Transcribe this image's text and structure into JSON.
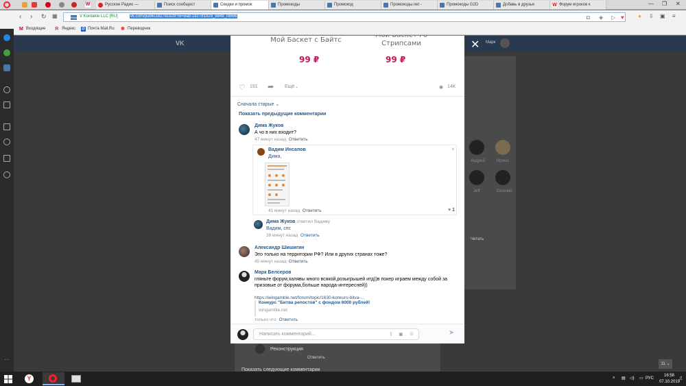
{
  "browser": {
    "tabs": [
      {
        "label": "Русское Радио —"
      },
      {
        "label": "Поиск сообщест"
      },
      {
        "label": "Скидки и промок"
      },
      {
        "label": "Промокоды"
      },
      {
        "label": "Промокод"
      },
      {
        "label": "Промокоды.net - "
      },
      {
        "label": "Промокоды G2D"
      },
      {
        "label": "Добавь в друзья"
      },
      {
        "label": "Форум игроков к"
      }
    ],
    "https_badge": "https",
    "secure_label": "V Kontakte LLC [RU]",
    "url": "vk.com/public182781929?w=wall-182781929_8849_r8866",
    "bookmarks": [
      "Входящие",
      "Яндекс",
      "Почта Mail.Ru",
      "Переводчик"
    ]
  },
  "vk": {
    "user_name": "Марк",
    "right_labels": [
      "Андрей",
      "Ирина",
      "Jeff",
      "Евгений"
    ],
    "read_button": "Читать"
  },
  "modal": {
    "products": [
      {
        "name": "Мой Баскет с Байтс",
        "price": "99 ₽"
      },
      {
        "name": "Мой Баскет Ро\nСтрипсами",
        "price": "99 ₽"
      }
    ],
    "likes": "191",
    "more": "Ещё",
    "views": "14K",
    "sort_label": "Сначала старые",
    "show_prev": "Показать предыдущие комментарии",
    "comments": [
      {
        "name": "Дима Жуков",
        "text": "А чо в них входит?",
        "time": "47 минут назад",
        "reply": "Ответить"
      },
      {
        "name": "Вадим Инсапов",
        "text": "Дима,",
        "time": "41 минут назад",
        "reply": "Ответить",
        "likes": "1"
      },
      {
        "name": "Дима Жуков",
        "replied_to": "ответил Вадиму",
        "text": "Вадим, спс",
        "time": "38 минут назад",
        "reply": "Ответить"
      },
      {
        "name": "Александр Шишигин",
        "text": "Это только на территории РФ? Или в других странах тоже?",
        "time": "45 минут назад",
        "reply": "Ответить"
      },
      {
        "name": "Марк Белсеров",
        "text1": "гляньте форум,халявы много всякой,розыгрышей итд))в покер играем между собой за",
        "text2": "призовые от форума,больше народа-интересней))",
        "link": "https://wingamble.net/forum/topic/1630-konkurs-bitva-...",
        "card_title": "Конкурс \"Битва репостов\" с фондом 6000 рублей!",
        "card_domain": "wingamble.net",
        "time": "только что",
        "reply": "Ответить"
      }
    ],
    "input_placeholder": "Написать комментарий..."
  },
  "background": {
    "comment_name": "Реконструкция",
    "comment_reply": "Ответить",
    "show_next": "Показать следующие комментарии"
  },
  "taskbar": {
    "lang": "РУС",
    "time": "16:58",
    "date": "07.10.2019",
    "badge": "11"
  }
}
